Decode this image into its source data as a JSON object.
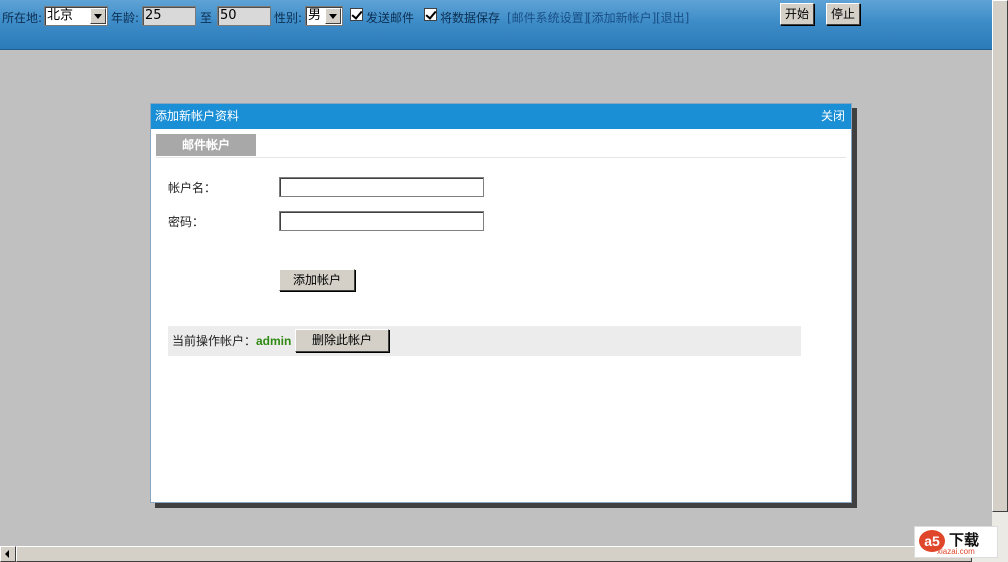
{
  "toolbar": {
    "location_label": "所在地:",
    "location_value": "北京",
    "age_label": "年龄:",
    "age_from": "25",
    "age_to_label": "至",
    "age_to": "50",
    "gender_label": "性别:",
    "gender_value": "男",
    "send_mail_label": "发送邮件",
    "send_mail_checked": true,
    "save_data_label": "将数据保存",
    "save_data_checked": true,
    "mail_settings_link": "[邮件系统设置]",
    "add_account_link": "[添加新帐户]",
    "logout_link": "[退出]",
    "start_button": "开始",
    "stop_button": "停止"
  },
  "dialog": {
    "title": "添加新帐户资料",
    "close_label": "关闭",
    "tab_label": "邮件帐户",
    "account_label": "帐户名：",
    "account_value": "",
    "password_label": "密码：",
    "password_value": "",
    "add_button": "添加帐户",
    "current_label": "当前操作帐户：",
    "current_user": "admin",
    "delete_button": "删除此帐户"
  },
  "watermark": {
    "logo_mark": "a5",
    "logo_text": "下载",
    "logo_url_text": "xiazai.com"
  },
  "colors": {
    "toolbar_blue": "#2b7bb8",
    "dialog_header": "#1a8fd6",
    "current_user_green": "#2f8a12"
  }
}
